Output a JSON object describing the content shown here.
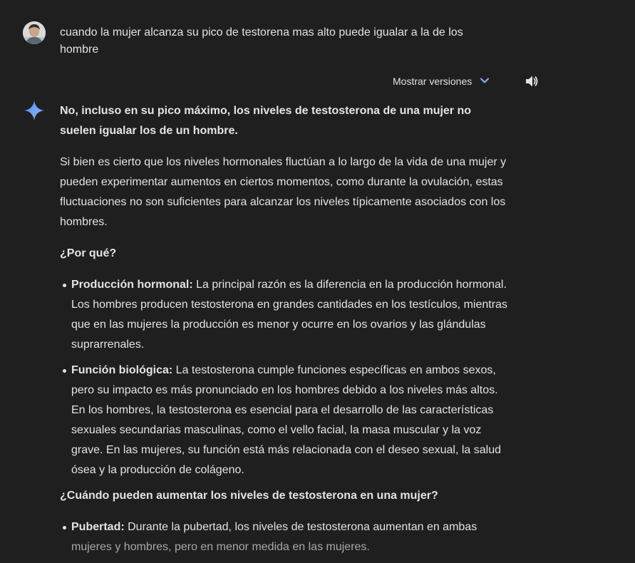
{
  "user": {
    "avatar_icon": "user-avatar",
    "prompt": "cuando la mujer alcanza su pico de testorena mas alto puede igualar a la de los hombre"
  },
  "toolbar": {
    "versions_label": "Mostrar versiones",
    "versions_icon": "chevron-down-icon",
    "speaker_icon": "speaker-icon",
    "accent": "#8ab4f8"
  },
  "response": {
    "icon": "gemini-spark-icon",
    "lead": "No, incluso en su pico máximo, los niveles de testosterona de una mujer no suelen igualar los de un hombre.",
    "intro": "Si bien es cierto que los niveles hormonales fluctúan a lo largo de la vida de una mujer y pueden experimentar aumentos en ciertos momentos, como durante la ovulación, estas fluctuaciones no son suficientes para alcanzar los niveles típicamente asociados con los hombres.",
    "why_heading": "¿Por qué?",
    "why_items": [
      {
        "term": "Producción hormonal:",
        "text": " La principal razón es la diferencia en la producción hormonal. Los hombres producen testosterona en grandes cantidades en los testículos, mientras que en las mujeres la producción es menor y ocurre en los ovarios y las glándulas suprarrenales."
      },
      {
        "term": "Función biológica:",
        "text": " La testosterona cumple funciones específicas en ambos sexos, pero su impacto es más pronunciado en los hombres debido a los niveles más altos. En los hombres, la testosterona es esencial para el desarrollo de las características sexuales secundarias masculinas, como el vello facial, la masa muscular y la voz grave. En las mujeres, su función está más relacionada con el deseo sexual, la salud ósea y la producción de colágeno."
      }
    ],
    "when_heading": "¿Cuándo pueden aumentar los niveles de testosterona en una mujer?",
    "when_items": [
      {
        "term": "Pubertad:",
        "text_a": " Durante la pubertad, los niveles de testosterona aumentan en ambas",
        "text_b": " mujeres y hombres, pero en menor medida en las mujeres."
      }
    ]
  }
}
